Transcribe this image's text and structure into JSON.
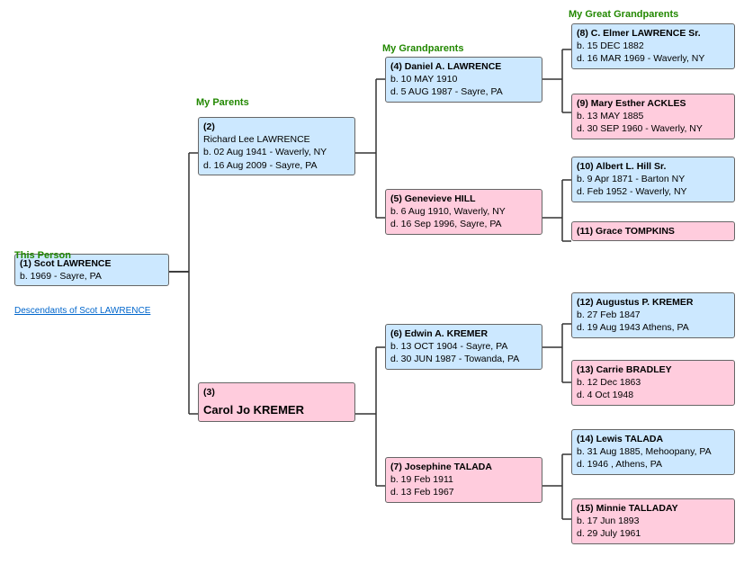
{
  "labels": {
    "this_person": "This Person",
    "my_parents": "My Parents",
    "my_grandparents": "My Grandparents",
    "my_great_grandparents": "My Great Grandparents",
    "descendants_link": "Descendants of Scot LAWRENCE"
  },
  "persons": {
    "p1": {
      "id": 1,
      "name": "(1) Scot LAWRENCE",
      "line2": "b. 1969 - Sayre, PA",
      "line3": "",
      "gender": "male"
    },
    "p2": {
      "id": 2,
      "name": "(2)",
      "line2": "Richard Lee LAWRENCE",
      "line3": "b. 02 Aug 1941 - Waverly, NY",
      "line4": "d. 16 Aug 2009 - Sayre, PA",
      "gender": "male"
    },
    "p3": {
      "id": 3,
      "name": "(3)",
      "line2": "Carol Jo KREMER",
      "gender": "female"
    },
    "p4": {
      "id": 4,
      "name": "(4) Daniel A. LAWRENCE",
      "line2": "b. 10 MAY 1910",
      "line3": "d.   5 AUG 1987 - Sayre, PA",
      "gender": "male"
    },
    "p5": {
      "id": 5,
      "name": "(5) Genevieve HILL",
      "line2": "b.   6 Aug 1910, Waverly, NY",
      "line3": "d. 16 Sep 1996, Sayre, PA",
      "gender": "female"
    },
    "p6": {
      "id": 6,
      "name": "(6) Edwin A. KREMER",
      "line2": "b. 13 OCT 1904 - Sayre, PA",
      "line3": "d. 30 JUN 1987 - Towanda, PA",
      "gender": "male"
    },
    "p7": {
      "id": 7,
      "name": "(7) Josephine TALADA",
      "line2": "b. 19 Feb 1911",
      "line3": "d. 13 Feb 1967",
      "gender": "female"
    },
    "p8": {
      "id": 8,
      "name": "(8) C. Elmer LAWRENCE Sr.",
      "line2": "b. 15 DEC 1882",
      "line3": "d. 16 MAR 1969 - Waverly, NY",
      "gender": "male"
    },
    "p9": {
      "id": 9,
      "name": "(9) Mary Esther ACKLES",
      "line2": "b. 13 MAY 1885",
      "line3": "d. 30 SEP 1960 - Waverly, NY",
      "gender": "female"
    },
    "p10": {
      "id": 10,
      "name": "(10) Albert L. Hill Sr.",
      "line2": "b.  9 Apr 1871 - Barton NY",
      "line3": "d.  Feb 1952 - Waverly, NY",
      "gender": "male"
    },
    "p11": {
      "id": 11,
      "name": "(11) Grace TOMPKINS",
      "gender": "female"
    },
    "p12": {
      "id": 12,
      "name": "(12) Augustus P. KREMER",
      "line2": "b. 27 Feb 1847",
      "line3": "d. 19 Aug 1943  Athens, PA",
      "gender": "male"
    },
    "p13": {
      "id": 13,
      "name": "(13) Carrie BRADLEY",
      "line2": "b. 12 Dec 1863",
      "line3": "d. 4 Oct 1948",
      "gender": "female"
    },
    "p14": {
      "id": 14,
      "name": "(14) Lewis TALADA",
      "line2": "b. 31 Aug 1885, Mehoopany, PA",
      "line3": "d. 1946 , Athens, PA",
      "gender": "male"
    },
    "p15": {
      "id": 15,
      "name": "(15) Minnie TALLADAY",
      "line2": "b. 17 Jun 1893",
      "line3": "d. 29 July 1961",
      "gender": "female"
    }
  }
}
